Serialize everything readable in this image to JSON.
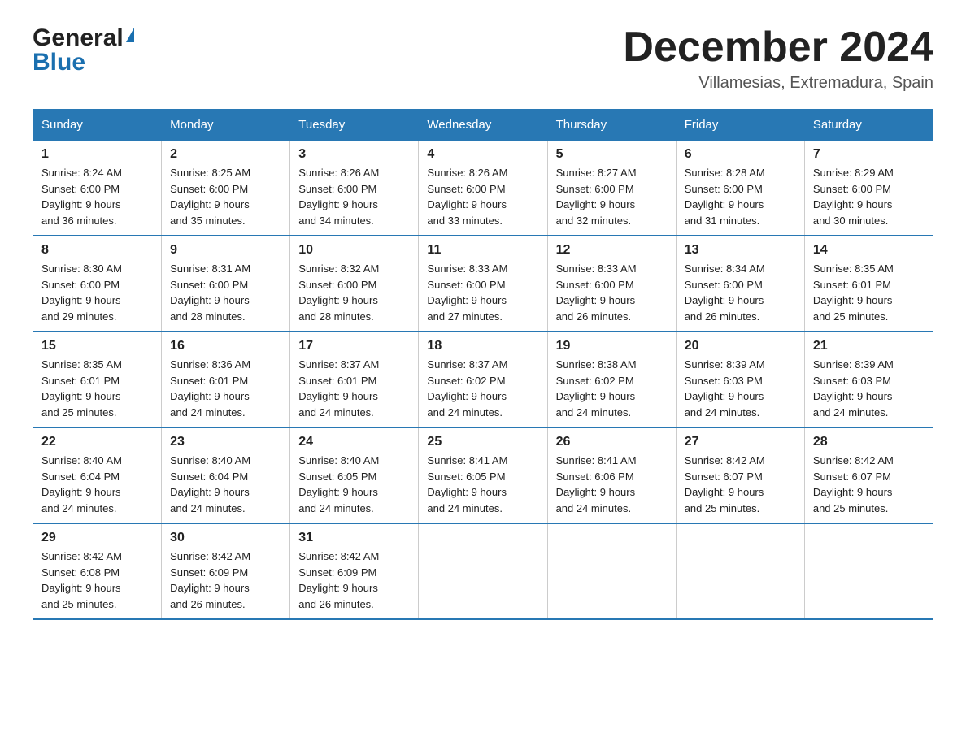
{
  "header": {
    "logo_general": "General",
    "logo_blue": "Blue",
    "month": "December 2024",
    "location": "Villamesias, Extremadura, Spain"
  },
  "days_of_week": [
    "Sunday",
    "Monday",
    "Tuesday",
    "Wednesday",
    "Thursday",
    "Friday",
    "Saturday"
  ],
  "weeks": [
    [
      {
        "num": "1",
        "sunrise": "8:24 AM",
        "sunset": "6:00 PM",
        "daylight": "9 hours and 36 minutes."
      },
      {
        "num": "2",
        "sunrise": "8:25 AM",
        "sunset": "6:00 PM",
        "daylight": "9 hours and 35 minutes."
      },
      {
        "num": "3",
        "sunrise": "8:26 AM",
        "sunset": "6:00 PM",
        "daylight": "9 hours and 34 minutes."
      },
      {
        "num": "4",
        "sunrise": "8:26 AM",
        "sunset": "6:00 PM",
        "daylight": "9 hours and 33 minutes."
      },
      {
        "num": "5",
        "sunrise": "8:27 AM",
        "sunset": "6:00 PM",
        "daylight": "9 hours and 32 minutes."
      },
      {
        "num": "6",
        "sunrise": "8:28 AM",
        "sunset": "6:00 PM",
        "daylight": "9 hours and 31 minutes."
      },
      {
        "num": "7",
        "sunrise": "8:29 AM",
        "sunset": "6:00 PM",
        "daylight": "9 hours and 30 minutes."
      }
    ],
    [
      {
        "num": "8",
        "sunrise": "8:30 AM",
        "sunset": "6:00 PM",
        "daylight": "9 hours and 29 minutes."
      },
      {
        "num": "9",
        "sunrise": "8:31 AM",
        "sunset": "6:00 PM",
        "daylight": "9 hours and 28 minutes."
      },
      {
        "num": "10",
        "sunrise": "8:32 AM",
        "sunset": "6:00 PM",
        "daylight": "9 hours and 28 minutes."
      },
      {
        "num": "11",
        "sunrise": "8:33 AM",
        "sunset": "6:00 PM",
        "daylight": "9 hours and 27 minutes."
      },
      {
        "num": "12",
        "sunrise": "8:33 AM",
        "sunset": "6:00 PM",
        "daylight": "9 hours and 26 minutes."
      },
      {
        "num": "13",
        "sunrise": "8:34 AM",
        "sunset": "6:00 PM",
        "daylight": "9 hours and 26 minutes."
      },
      {
        "num": "14",
        "sunrise": "8:35 AM",
        "sunset": "6:01 PM",
        "daylight": "9 hours and 25 minutes."
      }
    ],
    [
      {
        "num": "15",
        "sunrise": "8:35 AM",
        "sunset": "6:01 PM",
        "daylight": "9 hours and 25 minutes."
      },
      {
        "num": "16",
        "sunrise": "8:36 AM",
        "sunset": "6:01 PM",
        "daylight": "9 hours and 24 minutes."
      },
      {
        "num": "17",
        "sunrise": "8:37 AM",
        "sunset": "6:01 PM",
        "daylight": "9 hours and 24 minutes."
      },
      {
        "num": "18",
        "sunrise": "8:37 AM",
        "sunset": "6:02 PM",
        "daylight": "9 hours and 24 minutes."
      },
      {
        "num": "19",
        "sunrise": "8:38 AM",
        "sunset": "6:02 PM",
        "daylight": "9 hours and 24 minutes."
      },
      {
        "num": "20",
        "sunrise": "8:39 AM",
        "sunset": "6:03 PM",
        "daylight": "9 hours and 24 minutes."
      },
      {
        "num": "21",
        "sunrise": "8:39 AM",
        "sunset": "6:03 PM",
        "daylight": "9 hours and 24 minutes."
      }
    ],
    [
      {
        "num": "22",
        "sunrise": "8:40 AM",
        "sunset": "6:04 PM",
        "daylight": "9 hours and 24 minutes."
      },
      {
        "num": "23",
        "sunrise": "8:40 AM",
        "sunset": "6:04 PM",
        "daylight": "9 hours and 24 minutes."
      },
      {
        "num": "24",
        "sunrise": "8:40 AM",
        "sunset": "6:05 PM",
        "daylight": "9 hours and 24 minutes."
      },
      {
        "num": "25",
        "sunrise": "8:41 AM",
        "sunset": "6:05 PM",
        "daylight": "9 hours and 24 minutes."
      },
      {
        "num": "26",
        "sunrise": "8:41 AM",
        "sunset": "6:06 PM",
        "daylight": "9 hours and 24 minutes."
      },
      {
        "num": "27",
        "sunrise": "8:42 AM",
        "sunset": "6:07 PM",
        "daylight": "9 hours and 25 minutes."
      },
      {
        "num": "28",
        "sunrise": "8:42 AM",
        "sunset": "6:07 PM",
        "daylight": "9 hours and 25 minutes."
      }
    ],
    [
      {
        "num": "29",
        "sunrise": "8:42 AM",
        "sunset": "6:08 PM",
        "daylight": "9 hours and 25 minutes."
      },
      {
        "num": "30",
        "sunrise": "8:42 AM",
        "sunset": "6:09 PM",
        "daylight": "9 hours and 26 minutes."
      },
      {
        "num": "31",
        "sunrise": "8:42 AM",
        "sunset": "6:09 PM",
        "daylight": "9 hours and 26 minutes."
      },
      null,
      null,
      null,
      null
    ]
  ],
  "labels": {
    "sunrise": "Sunrise:",
    "sunset": "Sunset:",
    "daylight": "Daylight:"
  }
}
